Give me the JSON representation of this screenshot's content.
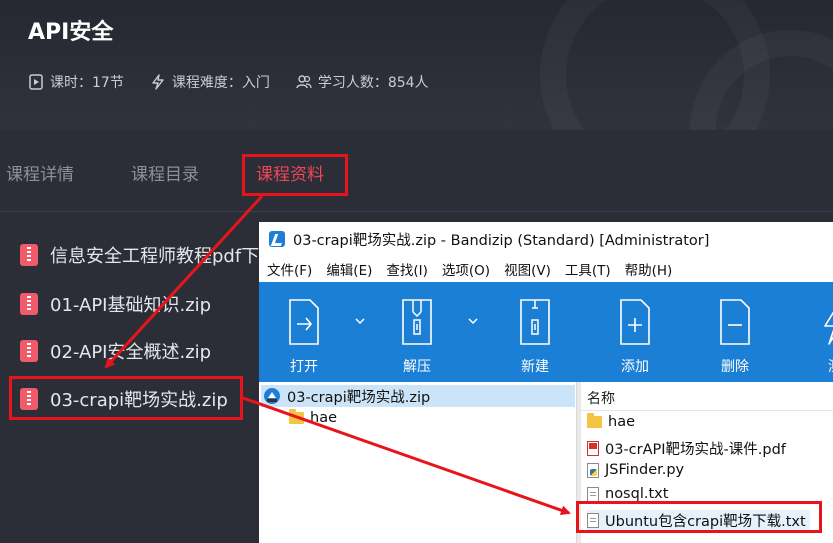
{
  "course": {
    "title": "API安全",
    "meta": [
      {
        "icon": "lesson-icon",
        "text": "课时：17节"
      },
      {
        "icon": "difficulty-icon",
        "text": "课程难度：入门"
      },
      {
        "icon": "students-icon",
        "text": "学习人数：854人"
      }
    ],
    "tabs": [
      {
        "label": "课程详情",
        "active": false
      },
      {
        "label": "课程目录",
        "active": false
      },
      {
        "label": "课程资料",
        "active": true
      }
    ],
    "files": [
      {
        "name": "信息安全工程师教程pdf下载"
      },
      {
        "name": "01-API基础知识.zip"
      },
      {
        "name": "02-API安全概述.zip"
      },
      {
        "name": "03-crapi靶场实战.zip"
      }
    ]
  },
  "bandizip": {
    "title": "03-crapi靶场实战.zip - Bandizip (Standard) [Administrator]",
    "menu": [
      "文件(F)",
      "编辑(E)",
      "查找(I)",
      "选项(O)",
      "视图(V)",
      "工具(T)",
      "帮助(H)"
    ],
    "toolbar": [
      "打开",
      "解压",
      "新建",
      "添加",
      "删除",
      "测"
    ],
    "tree": {
      "root": "03-crapi靶场实战.zip",
      "children": [
        "hae"
      ]
    },
    "list": {
      "column": "名称",
      "items": [
        {
          "name": "hae",
          "type": "folder"
        },
        {
          "name": "03-crAPI靶场实战-课件.pdf",
          "type": "pdf"
        },
        {
          "name": "JSFinder.py",
          "type": "py"
        },
        {
          "name": "nosql.txt",
          "type": "txt"
        },
        {
          "name": "Ubuntu包含crapi靶场下载.txt",
          "type": "txt"
        }
      ]
    }
  },
  "colors": {
    "accent_red": "#e8141c",
    "active_tab": "#f0465a",
    "toolbar_blue": "#1c7fd6",
    "page_bg": "#2b2e37"
  }
}
